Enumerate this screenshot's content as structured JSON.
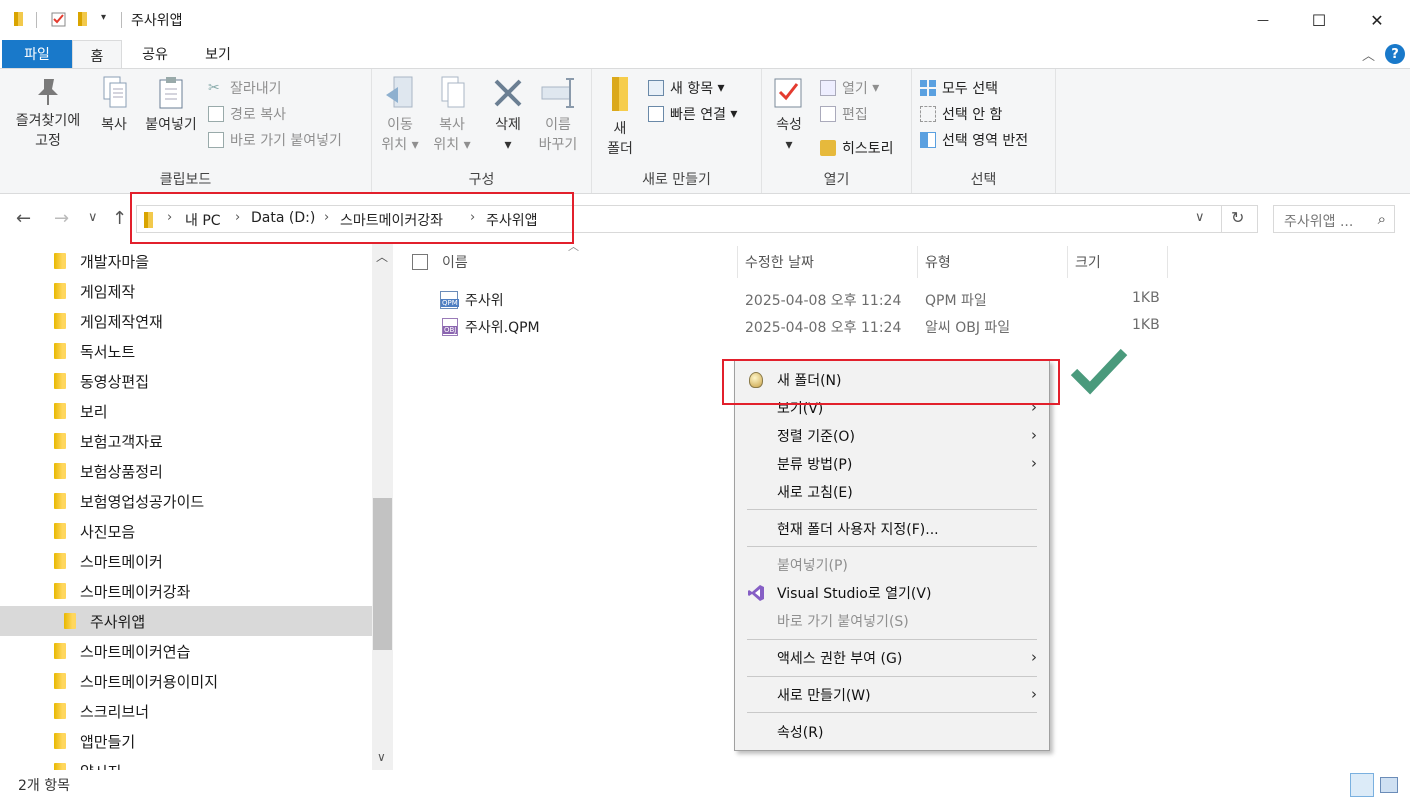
{
  "window": {
    "title": "주사위앱",
    "minimize": "—",
    "maximize": "☐",
    "close": "✕"
  },
  "ribbon_tabs": [
    "파일",
    "홈",
    "공유",
    "보기"
  ],
  "ribbon": {
    "clipboard": {
      "pin_label_1": "즐겨찾기에",
      "pin_label_2": "고정",
      "copy": "복사",
      "paste": "붙여넣기",
      "cut": "잘라내기",
      "copy_path": "경로 복사",
      "paste_shortcut": "바로 가기 붙여넣기",
      "group": "클립보드"
    },
    "organize": {
      "move_1": "이동",
      "move_2": "위치",
      "copyto_1": "복사",
      "copyto_2": "위치",
      "delete": "삭제",
      "rename_1": "이름",
      "rename_2": "바꾸기",
      "group": "구성"
    },
    "new": {
      "new_folder_1": "새",
      "new_folder_2": "폴더",
      "new_item": "새 항목",
      "easy_access": "빠른 연결",
      "group": "새로 만들기"
    },
    "open": {
      "properties": "속성",
      "open": "열기",
      "edit": "편집",
      "history": "히스토리",
      "group": "열기"
    },
    "select": {
      "select_all": "모두 선택",
      "select_none": "선택 안 함",
      "invert": "선택 영역 반전",
      "group": "선택"
    }
  },
  "address": {
    "crumbs": [
      "내 PC",
      "Data (D:)",
      "스마트메이커강좌",
      "주사위앱"
    ],
    "search_placeholder": "주사위앱 ..."
  },
  "tree": [
    "개발자마을",
    "게임제작",
    "게임제작연재",
    "독서노트",
    "동영상편집",
    "보리",
    "보험고객자료",
    "보험상품정리",
    "보험영업성공가이드",
    "사진모음",
    "스마트메이커",
    "스마트메이커강좌",
    "주사위앱",
    "스마트메이커연습",
    "스마트메이커용이미지",
    "스크리브너",
    "앱만들기",
    "약시지"
  ],
  "columns": {
    "name": "이름",
    "date": "수정한 날짜",
    "type": "유형",
    "size": "크기"
  },
  "files": [
    {
      "name": "주사위",
      "date": "2025-04-08 오후 11:24",
      "type": "QPM 파일",
      "size": "1KB",
      "icon": "QPM"
    },
    {
      "name": "주사위.QPM",
      "date": "2025-04-08 오후 11:24",
      "type": "알씨 OBJ 파일",
      "size": "1KB",
      "icon": "OBJ"
    }
  ],
  "context_menu": [
    {
      "label": "새 폴더(N)",
      "disabled": false,
      "submenu": false
    },
    {
      "label": "보기(V)",
      "disabled": false,
      "submenu": true
    },
    {
      "label": "정렬 기준(O)",
      "disabled": false,
      "submenu": true
    },
    {
      "label": "분류 방법(P)",
      "disabled": false,
      "submenu": true
    },
    {
      "label": "새로 고침(E)",
      "disabled": false,
      "submenu": false
    },
    {
      "label": "현재 폴더 사용자 지정(F)...",
      "disabled": false,
      "submenu": false
    },
    {
      "label": "붙여넣기(P)",
      "disabled": true,
      "submenu": false
    },
    {
      "label": "Visual Studio로 열기(V)",
      "disabled": false,
      "submenu": false
    },
    {
      "label": "바로 가기 붙여넣기(S)",
      "disabled": true,
      "submenu": false
    },
    {
      "label": "액세스 권한 부여 (G)",
      "disabled": false,
      "submenu": true
    },
    {
      "label": "새로 만들기(W)",
      "disabled": false,
      "submenu": true
    },
    {
      "label": "속성(R)",
      "disabled": false,
      "submenu": false
    }
  ],
  "status": {
    "item_count": "2개 항목"
  },
  "colors": {
    "accent_blue": "#1979ca",
    "highlight_red": "#e2202c",
    "check_green": "#4a9a7c"
  }
}
